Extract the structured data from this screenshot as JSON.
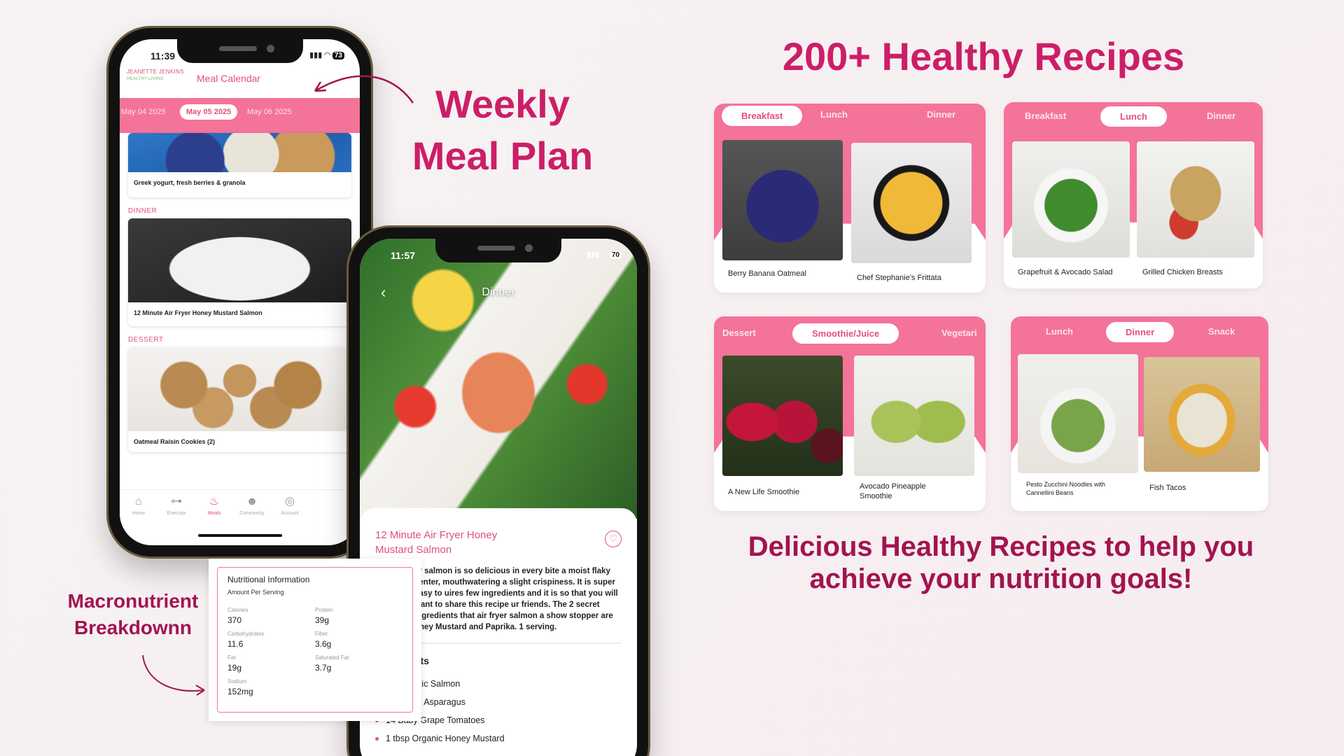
{
  "headlines": {
    "weekly_line1": "Weekly",
    "weekly_line2": "Meal Plan",
    "macro_line1": "Macronutrient",
    "macro_line2": "Breakdownn",
    "recipes": "200+ Healthy Recipes",
    "tagline_line1": "Delicious Healthy Recipes to help you",
    "tagline_line2": "achieve your nutrition goals!"
  },
  "colors": {
    "brand_pink": "#f47399",
    "headline": "#cc1e68",
    "accent_dark": "#a21450"
  },
  "phone1": {
    "time": "11:39",
    "battery": "73",
    "logo_line1": "JEANETTE JENKINS",
    "logo_line2": "HEALTHY LIVING",
    "title": "Meal Calendar",
    "dates": [
      "May 04 2025",
      "May 05 2025",
      "May 06 2025"
    ],
    "active_date_index": 1,
    "meals": [
      {
        "section": "",
        "name": "Greek yogurt, fresh berries & granola",
        "image": "yogurt"
      },
      {
        "section": "DINNER",
        "name": "12 Minute Air Fryer Honey Mustard Salmon",
        "image": "salmon"
      },
      {
        "section": "DESSERT",
        "name": "Oatmeal Raisin Cookies (2)",
        "image": "cookies"
      }
    ],
    "tabs": [
      {
        "label": "Home",
        "icon": "home-icon"
      },
      {
        "label": "Exercise",
        "icon": "dumbbell-icon"
      },
      {
        "label": "Meals",
        "icon": "meals-icon"
      },
      {
        "label": "Community",
        "icon": "community-icon"
      },
      {
        "label": "Account",
        "icon": "account-icon"
      }
    ],
    "active_tab_index": 2
  },
  "phone2": {
    "time": "11:57",
    "battery": "70",
    "title": "Dinner",
    "recipe_title": "12 Minute Air Fryer Honey Mustard Salmon",
    "description": "er salmon is so delicious in every bite a moist flaky center, mouthwatering a slight crispiness. It is super easy to uires few ingredients and it is so that you will want to share this recipe ur friends. The 2 secret ingredients that air fryer salmon a show stopper are oney Mustard and Paprika.  1 serving.",
    "ingredients_heading": "nts",
    "ingredients": [
      "ntic Salmon",
      "rs Asparagus",
      "14 Baby Grape Tomatoes",
      "1 tbsp Organic Honey Mustard"
    ]
  },
  "nutrition": {
    "title": "Nutritional Information",
    "subtitle": "Amount Per Serving",
    "items": [
      {
        "label": "Calories",
        "value": "370"
      },
      {
        "label": "Protein",
        "value": "39g"
      },
      {
        "label": "Carbohydrates",
        "value": "11.6"
      },
      {
        "label": "Fiber",
        "value": "3.6g"
      },
      {
        "label": "Fat",
        "value": "19g"
      },
      {
        "label": "Saturated Fat",
        "value": "3.7g"
      },
      {
        "label": "Sodium",
        "value": "152mg"
      }
    ]
  },
  "recipe_cards": [
    {
      "tabs": [
        "Breakfast",
        "Lunch",
        "Dinner"
      ],
      "active": 0,
      "items": [
        {
          "name": "Berry Banana Oatmeal",
          "image": "oatmeal"
        },
        {
          "name": "Chef Stephanie's Frittata",
          "image": "frittata"
        }
      ]
    },
    {
      "tabs": [
        "Breakfast",
        "Lunch",
        "Dinner"
      ],
      "active": 1,
      "items": [
        {
          "name": "Grapefruit & Avocado Salad",
          "image": "salad"
        },
        {
          "name": "Grilled Chicken Breasts",
          "image": "chicken"
        }
      ]
    },
    {
      "tabs": [
        "Dessert",
        "Smoothie/Juice",
        "Vegetari"
      ],
      "active": 1,
      "items": [
        {
          "name": "A New Life Smoothie",
          "image": "red-smoothie"
        },
        {
          "name": "Avocado Pineapple Smoothie",
          "image": "green-smoothie"
        }
      ]
    },
    {
      "tabs": [
        "Lunch",
        "Dinner",
        "Snack"
      ],
      "active": 1,
      "items": [
        {
          "name": "Pesto Zucchini Noodles with Cannellini Beans",
          "image": "zucchini"
        },
        {
          "name": "Fish Tacos",
          "image": "tacos"
        }
      ]
    }
  ]
}
